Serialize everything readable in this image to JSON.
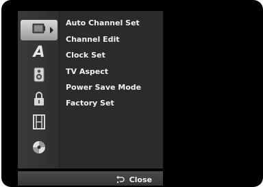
{
  "menu": {
    "items": [
      {
        "label": "Auto Channel Set"
      },
      {
        "label": "Channel Edit"
      },
      {
        "label": "Clock Set"
      },
      {
        "label": "TV Aspect"
      },
      {
        "label": "Power Save Mode"
      },
      {
        "label": "Factory Set"
      }
    ]
  },
  "sidebar": {
    "icons": [
      {
        "name": "general-settings-icon",
        "selected": true
      },
      {
        "name": "language-icon",
        "glyph": "A"
      },
      {
        "name": "audio-speaker-icon"
      },
      {
        "name": "lock-icon"
      },
      {
        "name": "film-recording-icon"
      },
      {
        "name": "disc-icon"
      }
    ]
  },
  "footer": {
    "close_label": "Close"
  },
  "colors": {
    "background": "#000000",
    "panel": "#2b2b2b",
    "selected_icon": "#bdbdbd",
    "text": "#f2f2f2"
  }
}
